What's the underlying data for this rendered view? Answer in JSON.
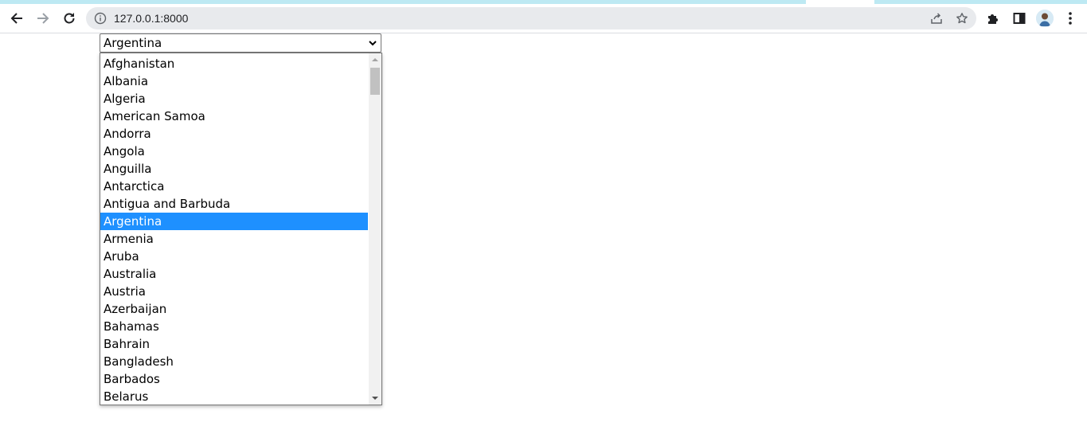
{
  "browser": {
    "url": "127.0.0.1:8000",
    "icons": {
      "back": "arrow-left-icon",
      "forward": "arrow-right-icon",
      "reload": "reload-icon",
      "site_info": "info-icon",
      "share": "share-icon",
      "bookmark": "star-icon",
      "extensions": "puzzle-icon",
      "side_panel": "side-panel-icon",
      "profile": "avatar",
      "menu": "kebab-menu-icon"
    }
  },
  "country_select": {
    "selected_value": "Argentina",
    "options": [
      {
        "label": "Afghanistan",
        "selected": false
      },
      {
        "label": "Albania",
        "selected": false
      },
      {
        "label": "Algeria",
        "selected": false
      },
      {
        "label": "American Samoa",
        "selected": false
      },
      {
        "label": "Andorra",
        "selected": false
      },
      {
        "label": "Angola",
        "selected": false
      },
      {
        "label": "Anguilla",
        "selected": false
      },
      {
        "label": "Antarctica",
        "selected": false
      },
      {
        "label": "Antigua and Barbuda",
        "selected": false
      },
      {
        "label": "Argentina",
        "selected": true
      },
      {
        "label": "Armenia",
        "selected": false
      },
      {
        "label": "Aruba",
        "selected": false
      },
      {
        "label": "Australia",
        "selected": false
      },
      {
        "label": "Austria",
        "selected": false
      },
      {
        "label": "Azerbaijan",
        "selected": false
      },
      {
        "label": "Bahamas",
        "selected": false
      },
      {
        "label": "Bahrain",
        "selected": false
      },
      {
        "label": "Bangladesh",
        "selected": false
      },
      {
        "label": "Barbados",
        "selected": false
      },
      {
        "label": "Belarus",
        "selected": false
      }
    ]
  },
  "colors": {
    "selection": "#1e90ff",
    "tab_accent": "#bde9f3"
  }
}
